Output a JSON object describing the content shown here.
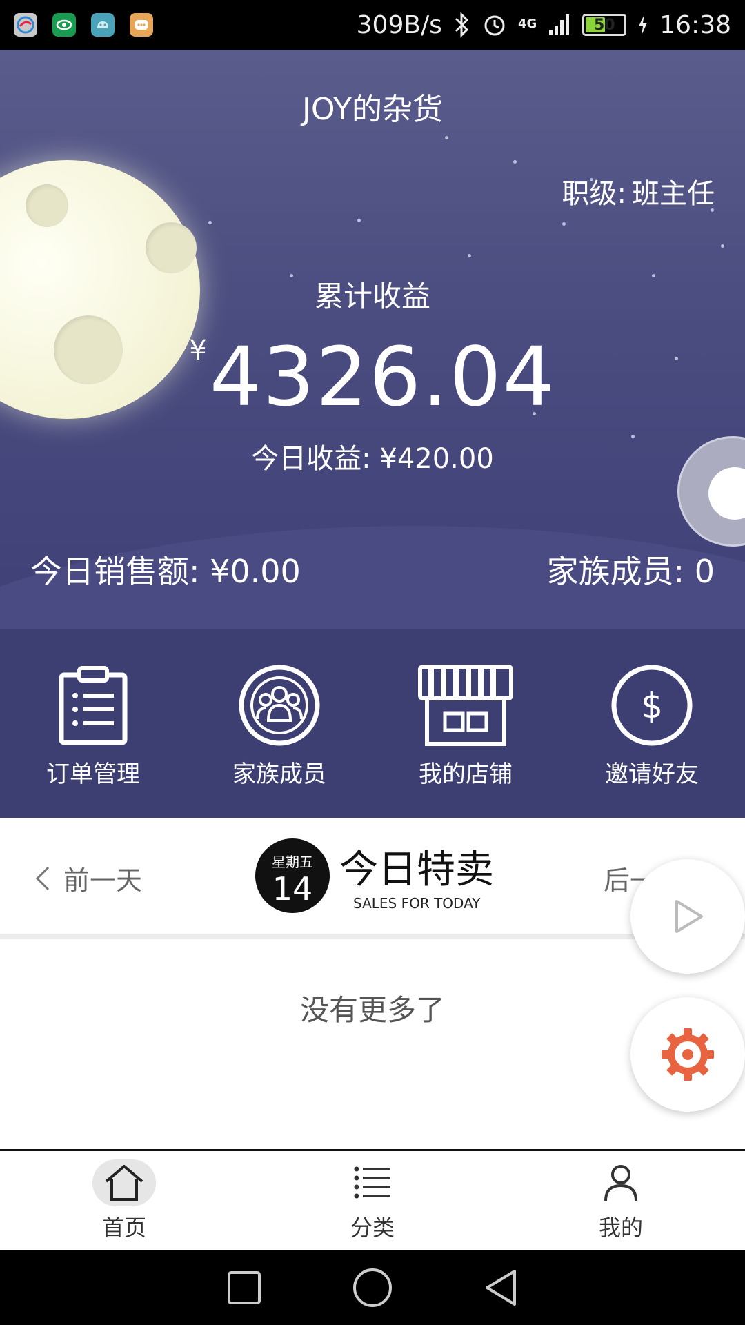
{
  "status_bar": {
    "net_speed": "309B/s",
    "network": "4G",
    "battery": "50",
    "time": "16:38"
  },
  "header": {
    "shop_name": "JOY的杂货",
    "rank_label": "职级:",
    "rank_value": "班主任",
    "cumulative_label": "累计收益",
    "currency": "¥",
    "cumulative_value": "4326.04",
    "today_earnings": "今日收益: ¥420.00",
    "today_sales": "今日销售额: ¥0.00",
    "family_members": "家族成员: 0"
  },
  "menu": {
    "items": [
      {
        "label": "订单管理",
        "icon": "clipboard-icon"
      },
      {
        "label": "家族成员",
        "icon": "group-icon"
      },
      {
        "label": "我的店铺",
        "icon": "store-icon"
      },
      {
        "label": "邀请好友",
        "icon": "dollar-icon"
      }
    ]
  },
  "daily": {
    "prev_label": "前一天",
    "next_label": "后一",
    "weekday": "星期五",
    "day": "14",
    "title": "今日特卖",
    "subtitle": "SALES FOR TODAY",
    "empty_text": "没有更多了"
  },
  "tabs": [
    {
      "label": "首页",
      "icon": "home-icon",
      "active": true
    },
    {
      "label": "分类",
      "icon": "list-icon",
      "active": false
    },
    {
      "label": "我的",
      "icon": "person-icon",
      "active": false
    }
  ],
  "colors": {
    "hero": "#4b4d80",
    "menu_bg": "#3d3f73",
    "settings_accent": "#e8633f"
  }
}
